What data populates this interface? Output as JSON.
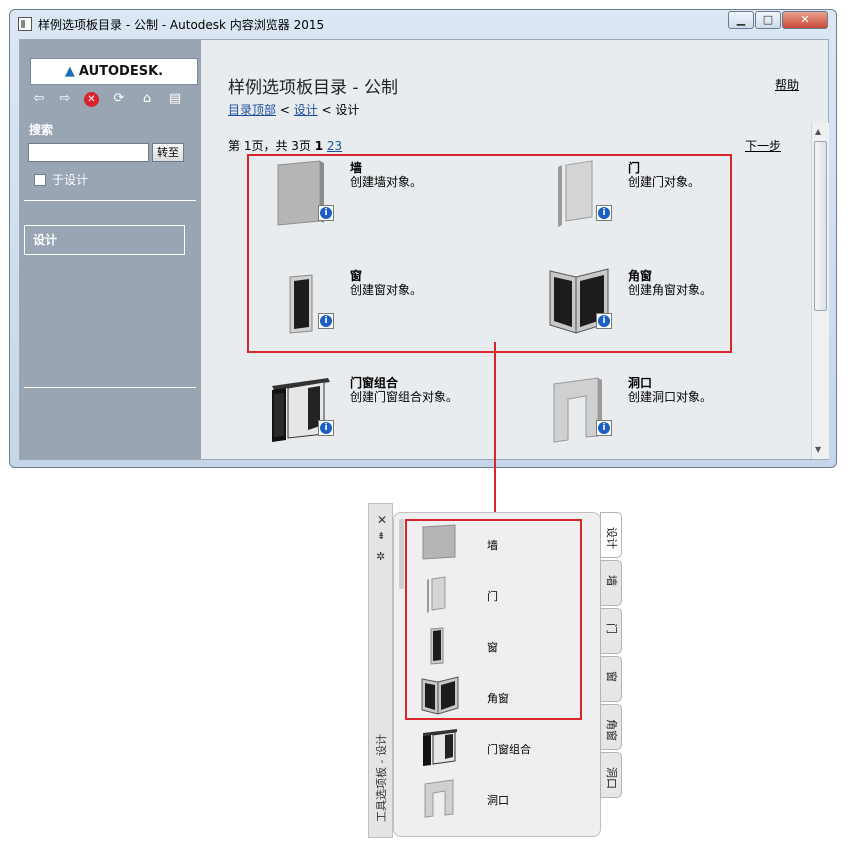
{
  "window": {
    "title": "样例选项板目录 - 公制 - Autodesk 内容浏览器 2015",
    "min_label": "▁",
    "max_label": "□",
    "close_label": "✕"
  },
  "sidebar": {
    "logo": "AUTODESK.",
    "search_label": "搜索",
    "search_value": "",
    "search_button": "转至",
    "checkbox_label": "于设计",
    "item": "设计"
  },
  "content": {
    "title": "样例选项板目录 - 公制",
    "help": "帮助",
    "breadcrumb_root": "目录顶部",
    "sep1": " < ",
    "breadcrumb_link": "设计",
    "sep2": " < ",
    "breadcrumb_current": "设计",
    "pager_text": "第 1页，共 3页 ",
    "page1": "1",
    "page2": "2",
    "page3": "3",
    "next": "下一步",
    "tiles": [
      {
        "name": "墙",
        "desc": "创建墙对象。"
      },
      {
        "name": "门",
        "desc": "创建门对象。"
      },
      {
        "name": "窗",
        "desc": "创建窗对象。"
      },
      {
        "name": "角窗",
        "desc": "创建角窗对象。"
      },
      {
        "name": "门窗组合",
        "desc": "创建门窗组合对象。"
      },
      {
        "name": "洞口",
        "desc": "创建洞口对象。"
      }
    ]
  },
  "palette": {
    "title": "工具选项板 - 设计",
    "items": [
      "墙",
      "门",
      "窗",
      "角窗",
      "门窗组合",
      "洞口"
    ],
    "tabs": [
      "设计",
      "墙",
      "门",
      "窗",
      "角窗",
      "洞口"
    ]
  },
  "colors": {
    "highlight": "#d7262d",
    "link": "#1a4fa0",
    "sidebar": "#9aa5b3",
    "info_icon": "#1b5fc4"
  }
}
